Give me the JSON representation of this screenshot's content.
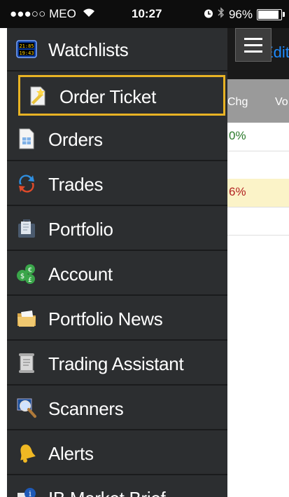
{
  "status_bar": {
    "carrier": "●●●○○ MEO",
    "time": "10:27",
    "battery": "96%",
    "battery_level": 0.96
  },
  "background": {
    "edit_label": "Edit",
    "col_chg": "Chg",
    "col_vol": "Vo",
    "rows": [
      {
        "value": "0%",
        "color": "#2a7a2a"
      },
      {
        "value": ""
      },
      {
        "value": "6%",
        "color": "#b22222"
      },
      {
        "value": ""
      }
    ]
  },
  "menu": {
    "items": [
      {
        "label": "Watchlists",
        "icon": "watchlist-clock-icon"
      },
      {
        "label": "Order Ticket",
        "icon": "order-ticket-icon",
        "selected": true
      },
      {
        "label": "Orders",
        "icon": "orders-document-icon"
      },
      {
        "label": "Trades",
        "icon": "trades-arrows-icon"
      },
      {
        "label": "Portfolio",
        "icon": "portfolio-briefcase-icon"
      },
      {
        "label": "Account",
        "icon": "account-coins-icon"
      },
      {
        "label": "Portfolio News",
        "icon": "news-folder-icon"
      },
      {
        "label": "Trading Assistant",
        "icon": "scroll-icon"
      },
      {
        "label": "Scanners",
        "icon": "scanner-magnifier-icon"
      },
      {
        "label": "Alerts",
        "icon": "bell-icon"
      },
      {
        "label": "IB Market Brief",
        "icon": "market-brief-icon"
      }
    ]
  },
  "colors": {
    "accent_selected": "#e8b324",
    "drawer_bg": "#2c2e30",
    "link_blue": "#1e8bff"
  }
}
